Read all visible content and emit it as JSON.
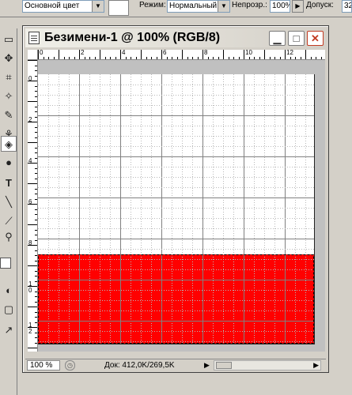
{
  "options_bar": {
    "source_value": "Основной цвет",
    "mode_label": "Режим:",
    "mode_value": "Нормальный",
    "opacity_label": "Непрозр.:",
    "opacity_value": "100%",
    "tolerance_label": "Допуск:",
    "tolerance_value": "32"
  },
  "toolbox": {
    "tools": [
      {
        "name": "move-tool",
        "glyph": "✥"
      },
      {
        "name": "magic-wand-tool",
        "glyph": "✧"
      },
      {
        "name": "brush-tool",
        "glyph": "✎"
      },
      {
        "name": "history-brush-tool",
        "glyph": "⚘"
      },
      {
        "name": "paint-bucket-tool",
        "glyph": "◈"
      },
      {
        "name": "burn-tool",
        "glyph": "●"
      },
      {
        "name": "type-tool",
        "glyph": "T"
      },
      {
        "name": "line-tool",
        "glyph": "╲"
      },
      {
        "name": "eyedropper-tool",
        "glyph": "⟋"
      },
      {
        "name": "zoom-tool",
        "glyph": "⚲"
      }
    ]
  },
  "document": {
    "title": "Безимени-1 @ 100% (RGB/8)",
    "buttons": {
      "minimize": "▁",
      "maximize": "□",
      "close": "✕"
    },
    "hruler_labels": [
      "0",
      "2",
      "4",
      "6",
      "8",
      "10",
      "12"
    ],
    "vruler_labels": [
      "0",
      "2",
      "4",
      "6",
      "8",
      "1 0",
      "1 2"
    ],
    "status": {
      "zoom": "100 %",
      "doc_info": "Док: 412,0K/269,5K",
      "arrow": "▶"
    }
  },
  "colors": {
    "fill": "#ff0000",
    "canvas": "#ffffff",
    "workspace": "#c0c0c0"
  }
}
